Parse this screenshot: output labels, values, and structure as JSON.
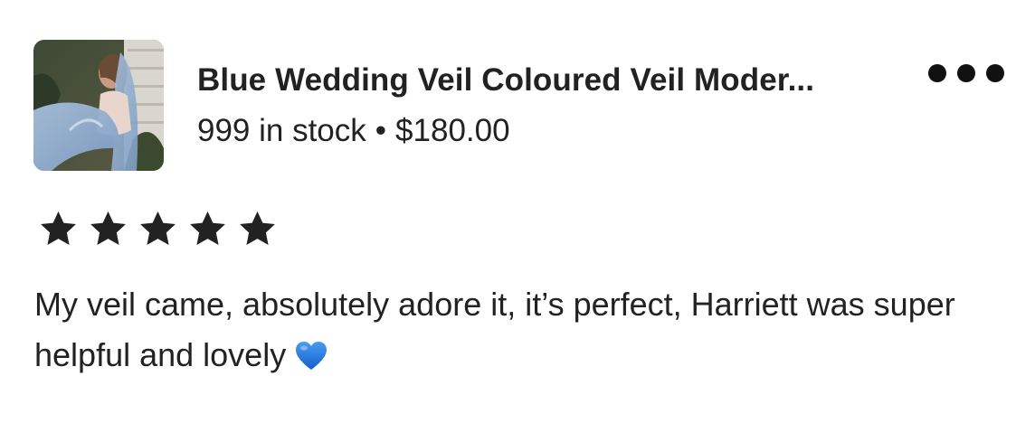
{
  "listing": {
    "title": "Blue Wedding Veil Coloured Veil Moder...",
    "stock": "999 in stock",
    "separator": "•",
    "price": "$180.00",
    "thumbnail_icon": "product-photo-bride-blue-veil"
  },
  "menu": {
    "icon": "more-horizontal-icon"
  },
  "rating": {
    "stars": 5,
    "max": 5,
    "star_color": "#222222"
  },
  "review": {
    "text": "My veil came, absolutely adore it, it’s perfect, Harriett was super helpful and lovely",
    "emoji": "blue-heart-icon",
    "emoji_color": "#1E6FD9"
  }
}
